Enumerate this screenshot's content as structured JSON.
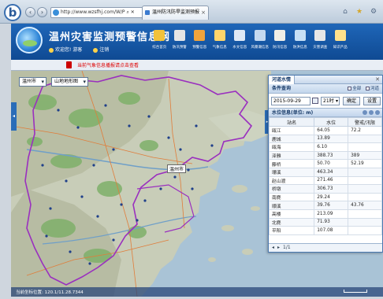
{
  "browser": {
    "address": "http://www.wzsfhj.com/W/P ⌕ ✕",
    "tab_title": "温州防汛防旱监测预报",
    "brand_letter": "b",
    "back": "‹",
    "forward": "›"
  },
  "app": {
    "title": "温州灾害监测预警信息网",
    "user_label": "欢迎您! 游客",
    "logout_label": "注销",
    "alert_text": "当前气象信息播报请点击查看",
    "toolbar": [
      {
        "label": "综合首页",
        "color": "#f2c23a"
      },
      {
        "label": "防汛预警",
        "color": "#e5e5e5"
      },
      {
        "label": "预警信息",
        "color": "#f0a43c"
      },
      {
        "label": "气象信息",
        "color": "#ffd66b"
      },
      {
        "label": "水文信息",
        "color": "#dfe9f5"
      },
      {
        "label": "风暴潮信息",
        "color": "#c4d9ef"
      },
      {
        "label": "防汛信息",
        "color": "#f1efe6"
      },
      {
        "label": "防洪信息",
        "color": "#c7e0f5"
      },
      {
        "label": "灾害调查",
        "color": "#e6e6e6"
      },
      {
        "label": "知识产品",
        "color": "#ffe18b"
      }
    ]
  },
  "map": {
    "region_select": "温州市",
    "layer_select": "山地地形图",
    "city_label": "温州市",
    "status": "当前坐标位置: 120.1/11.28.7344",
    "left_tab": "◂",
    "right_tab": "▸"
  },
  "panel": {
    "tab_label": "河道水情",
    "close": "✕",
    "section_title": "条件查询",
    "opt1": "全部",
    "opt2": "河道",
    "date": "2015-09-29",
    "hour": "21时",
    "query_btn": "确定",
    "reset_btn": "设置",
    "subsection": "水位信息(单位: m)",
    "columns": [
      "站名",
      "水位",
      "警戒/汛限"
    ],
    "rows": [
      [
        "瓯江",
        "64.05",
        "72.2"
      ],
      [
        "鹿城",
        "13.89",
        ""
      ],
      [
        "瓯海",
        "6.10",
        ""
      ],
      [
        "泽雅",
        "388.73",
        "389"
      ],
      [
        "藤桥",
        "50.70",
        "52.19"
      ],
      [
        "珊溪",
        "463.34",
        ""
      ],
      [
        "赵山渡",
        "271.46",
        ""
      ],
      [
        "桥墩",
        "306.73",
        ""
      ],
      [
        "南麂",
        "29.24",
        ""
      ],
      [
        "顺溪",
        "39.76",
        "43.76"
      ],
      [
        "高楼",
        "213.09",
        ""
      ],
      [
        "北麂",
        "71.93",
        ""
      ],
      [
        "平阳",
        "107.08",
        ""
      ]
    ],
    "pager": [
      "◂",
      "▸",
      "1/1"
    ]
  }
}
